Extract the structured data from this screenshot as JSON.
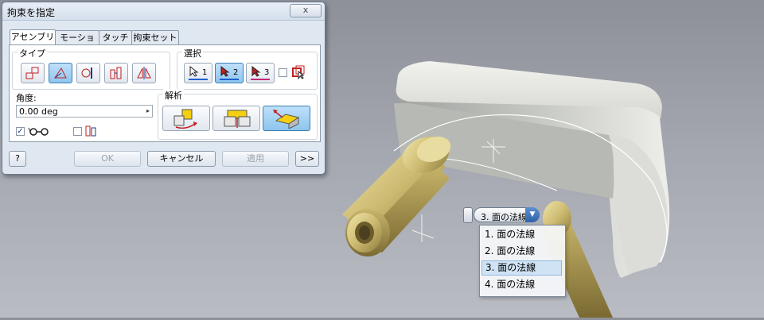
{
  "dialog": {
    "title": "拘束を指定",
    "close_label": "x",
    "tabs": [
      "アセンブリ",
      "モーション",
      "タッチ",
      "拘束セット"
    ],
    "active_tab": "アセンブリ",
    "type_group": {
      "label": "タイプ",
      "buttons": [
        "mate-icon",
        "angle-icon",
        "tangent-icon",
        "insert-icon",
        "symmetry-icon"
      ],
      "selected": "angle-icon"
    },
    "selection_group": {
      "label": "選択",
      "buttons": [
        {
          "number": "1",
          "color": "#1f5fd0"
        },
        {
          "number": "2",
          "color": "#1f5fd0"
        },
        {
          "number": "3",
          "color": "#c0287a"
        }
      ],
      "selected": "2",
      "preview_checked": false
    },
    "angle": {
      "label": "角度:",
      "value": "0.00 deg",
      "arrow": "▸"
    },
    "options": {
      "show_preview_checked": true,
      "predict_offset_checked": false
    },
    "solution_group": {
      "label": "解析",
      "buttons": [
        "directed-angle-icon",
        "undirected-angle-icon",
        "explicit-reference-vector-icon"
      ],
      "selected": "explicit-reference-vector-icon"
    },
    "footer": {
      "help": "?",
      "ok": "OK",
      "cancel": "キャンセル",
      "apply": "適用",
      "more": ">>"
    }
  },
  "viewport": {
    "selection_pill": "3. 面の法線",
    "pill_arrow": "▼",
    "dropdown_items": [
      "1. 面の法線",
      "2. 面の法線",
      "3. 面の法線",
      "4. 面の法線"
    ],
    "highlighted_item": "3. 面の法線"
  },
  "colors": {
    "accent": "#3c7fb1",
    "part_gold": "#d8c88a",
    "part_body": "#e6e7e2"
  }
}
